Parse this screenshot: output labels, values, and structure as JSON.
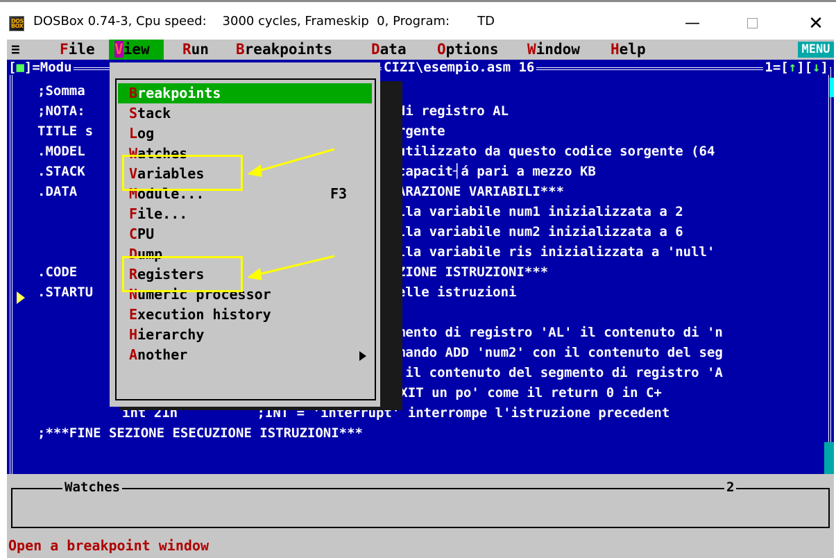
{
  "window": {
    "icon_text": "DOS BOX",
    "title": "DOSBox 0.74-3, Cpu speed:    3000 cycles, Frameskip  0, Program:       TD",
    "minimize": "—",
    "close": "✕"
  },
  "menubar": {
    "sys": "≡",
    "file": {
      "hk": "F",
      "rest": "ile"
    },
    "view": {
      "hk": "V",
      "rest": "iew"
    },
    "run": {
      "hk": "R",
      "rest": "un"
    },
    "breakpoints": {
      "hk": "B",
      "rest": "reakpoints"
    },
    "data": {
      "hk": "D",
      "rest": "ata"
    },
    "options": {
      "hk": "O",
      "rest": "ptions"
    },
    "window": {
      "hk": "W",
      "rest": "indow"
    },
    "help": {
      "hk": "H",
      "rest": "elp"
    },
    "badge": "MENU"
  },
  "module_window": {
    "title_left_open": "[",
    "title_left_box": "■",
    "title_left_rest": "]=Modu",
    "title_right": "CIZI\\esempio.asm 16",
    "num": "1=[",
    "up": "↑",
    "mid": "][",
    "down": "↓",
    "end": "]"
  },
  "code_left": [
    ";Somma",
    ";NOTA:",
    "TITLE s",
    ".MODEL",
    ".STACK",
    ".DATA",
    "",
    "",
    "",
    ".CODE",
    ".STARTU"
  ],
  "code_right": [
    "",
    "o di registro AL",
    "sorgente",
    "a utilizzato da questo codice sorgente (64",
    "n capacit┤á pari a mezzo KB",
    "HIARAZIONE VARIABILI***",
    "della variabile num1 inizializzata a 2",
    "della variabile num2 inizializzata a 6",
    "della variabile ris inizializzata a 'null'",
    "CUZIONE ISTRUZIONI***",
    " delle istruzioni",
    "",
    "egmento di registro 'AL' il contenuto di 'n",
    "comando ADD 'num2' con il contenuto del seg",
    "s' il contenuto del segmento di registro 'A"
  ],
  "code_full": [
    "mov AH,4Ch  ;4Ch ┤¿ il comando di EXIT un po' come il return 0 in C+",
    "int 21h          ;INT = 'interrupt' interrompe l'istruzione precedent",
    ";***FINE SEZIONE ESECUZIONE ISTRUZIONI***"
  ],
  "view_menu": [
    {
      "hk": "B",
      "rest": "reakpoints",
      "shortcut": "",
      "submenu": false,
      "selected": true
    },
    {
      "hk": "S",
      "rest": "tack",
      "shortcut": "",
      "submenu": false,
      "selected": false
    },
    {
      "hk": "L",
      "rest": "og",
      "shortcut": "",
      "submenu": false,
      "selected": false
    },
    {
      "hk": "W",
      "rest": "atches",
      "shortcut": "",
      "submenu": false,
      "selected": false
    },
    {
      "hk": "V",
      "rest": "ariables",
      "shortcut": "",
      "submenu": false,
      "selected": false
    },
    {
      "hk": "M",
      "rest": "odule...",
      "shortcut": "F3",
      "submenu": false,
      "selected": false
    },
    {
      "hk": "F",
      "rest": "ile...",
      "shortcut": "",
      "submenu": false,
      "selected": false
    },
    {
      "hk": "C",
      "rest": "PU",
      "shortcut": "",
      "submenu": false,
      "selected": false
    },
    {
      "hk": "D",
      "rest": "ump",
      "shortcut": "",
      "submenu": false,
      "selected": false
    },
    {
      "hk": "R",
      "rest": "egisters",
      "shortcut": "",
      "submenu": false,
      "selected": false
    },
    {
      "hk": "N",
      "rest": "umeric processor",
      "shortcut": "",
      "submenu": false,
      "selected": false
    },
    {
      "hk": "E",
      "rest": "xecution history",
      "shortcut": "",
      "submenu": false,
      "selected": false
    },
    {
      "hk": "H",
      "rest": "ierarchy",
      "shortcut": "",
      "submenu": false,
      "selected": false
    },
    {
      "hk": "A",
      "rest": "nother",
      "shortcut": "",
      "submenu": true,
      "selected": false
    }
  ],
  "watches": {
    "title": "Watches",
    "num": "2"
  },
  "status": "Open a breakpoint window",
  "colors": {
    "dos_blue": "#0000a8",
    "menu_gray": "#c6c6c6",
    "highlight_green": "#00a800",
    "hotkey_red": "#b00000",
    "annotation_yellow": "#ffff00",
    "scroll_cyan": "#00a8a8"
  }
}
